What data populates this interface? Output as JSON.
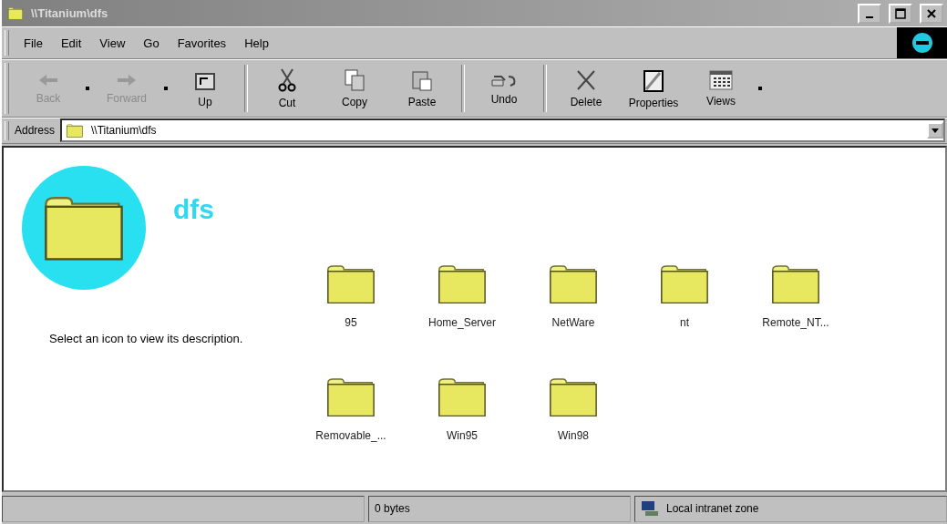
{
  "window": {
    "title": "\\\\Titanium\\dfs"
  },
  "menu": [
    "File",
    "Edit",
    "View",
    "Go",
    "Favorites",
    "Help"
  ],
  "toolbar": [
    {
      "kind": "back",
      "label": "Back",
      "disabled": true,
      "dropdown": true
    },
    {
      "kind": "forward",
      "label": "Forward",
      "disabled": true,
      "dropdown": true
    },
    {
      "kind": "up",
      "label": "Up",
      "disabled": false,
      "dropdown": false
    },
    {
      "kind": "separator"
    },
    {
      "kind": "cut",
      "label": "Cut",
      "disabled": false,
      "dropdown": false
    },
    {
      "kind": "copy",
      "label": "Copy",
      "disabled": false,
      "dropdown": false
    },
    {
      "kind": "paste",
      "label": "Paste",
      "disabled": false,
      "dropdown": false
    },
    {
      "kind": "separator"
    },
    {
      "kind": "undo",
      "label": "Undo",
      "disabled": false,
      "dropdown": false
    },
    {
      "kind": "separator"
    },
    {
      "kind": "delete",
      "label": "Delete",
      "disabled": false,
      "dropdown": false
    },
    {
      "kind": "properties",
      "label": "Properties",
      "disabled": false,
      "dropdown": false
    },
    {
      "kind": "views",
      "label": "Views",
      "disabled": false,
      "dropdown": true
    }
  ],
  "address": {
    "label": "Address",
    "value": "\\\\Titanium\\dfs"
  },
  "info_panel": {
    "folder_name": "dfs",
    "description": "Select an icon to view its description."
  },
  "folders": [
    "95",
    "Home_Server",
    "NetWare",
    "nt",
    "Remote_NT...",
    "Removable_...",
    "Win95",
    "Win98"
  ],
  "status_bar": {
    "size": "0 bytes",
    "zone": "Local intranet zone"
  }
}
